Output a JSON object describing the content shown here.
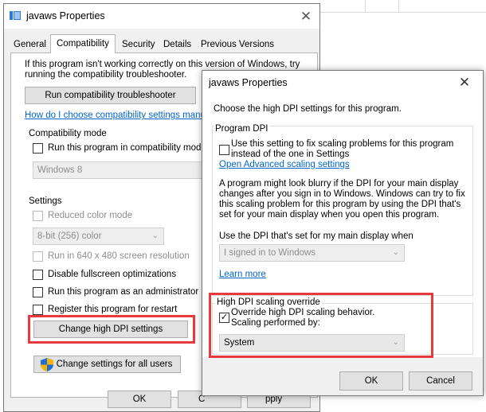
{
  "main_window": {
    "title": "javaws Properties",
    "close_glyph": "✕",
    "tabs": [
      "General",
      "Compatibility",
      "Security",
      "Details",
      "Previous Versions"
    ],
    "active_tab": "Compatibility",
    "intro_line1": "If this program isn't working correctly on this version of Windows, try",
    "intro_line2": "running the compatibility troubleshooter.",
    "troubleshooter_button": "Run compatibility troubleshooter",
    "help_link": "How do I choose compatibility settings manua",
    "compat_mode": {
      "label": "Compatibility mode",
      "checkbox": "Run this program in compatibility mode f",
      "select_value": "Windows 8"
    },
    "settings": {
      "label": "Settings",
      "reduced_color": "Reduced color mode",
      "color_select": "8-bit (256) color",
      "res_640": "Run in 640 x 480 screen resolution",
      "disable_fullscreen": "Disable fullscreen optimizations",
      "run_admin": "Run this program as an administrator",
      "register_restart": "Register this program for restart",
      "change_dpi_button": "Change high DPI settings"
    },
    "all_users_button": "Change settings for all users",
    "ok_button": "OK",
    "cancel_button_partial": "C",
    "apply_button_partial": "pply"
  },
  "dpi_dialog": {
    "title": "javaws Properties",
    "close_glyph": "✕",
    "intro": "Choose the high DPI settings for this program.",
    "program_dpi": {
      "label": "Program DPI",
      "checkbox_line1": "Use this setting to fix scaling problems for this program",
      "checkbox_line2": "instead of the one in Settings",
      "link": "Open Advanced scaling settings",
      "para_line1": "A program might look blurry if the DPI for your main display",
      "para_line2": "changes after you sign in to Windows. Windows can try to fix",
      "para_line3": "this scaling problem for this program by using the DPI that's",
      "para_line4": "set for your main display when you open this program.",
      "use_dpi_label": "Use the DPI that's set for my main display when",
      "select_value": "I signed in to Windows",
      "learn_more": "Learn more"
    },
    "override": {
      "label": "High DPI scaling override",
      "checkbox_line1": "Override high DPI scaling behavior.",
      "checkbox_line2": "Scaling performed by:",
      "checked": true,
      "select_value": "System"
    },
    "ok_button": "OK",
    "cancel_button": "Cancel"
  },
  "colors": {
    "highlight_red": "#e8393e",
    "link_blue": "#0066cc",
    "dialog_bg": "#f0f0f0"
  },
  "icons": [
    "app-window-icon",
    "close-icon",
    "chevron-down-icon",
    "shield-icon",
    "checkmark-icon"
  ]
}
